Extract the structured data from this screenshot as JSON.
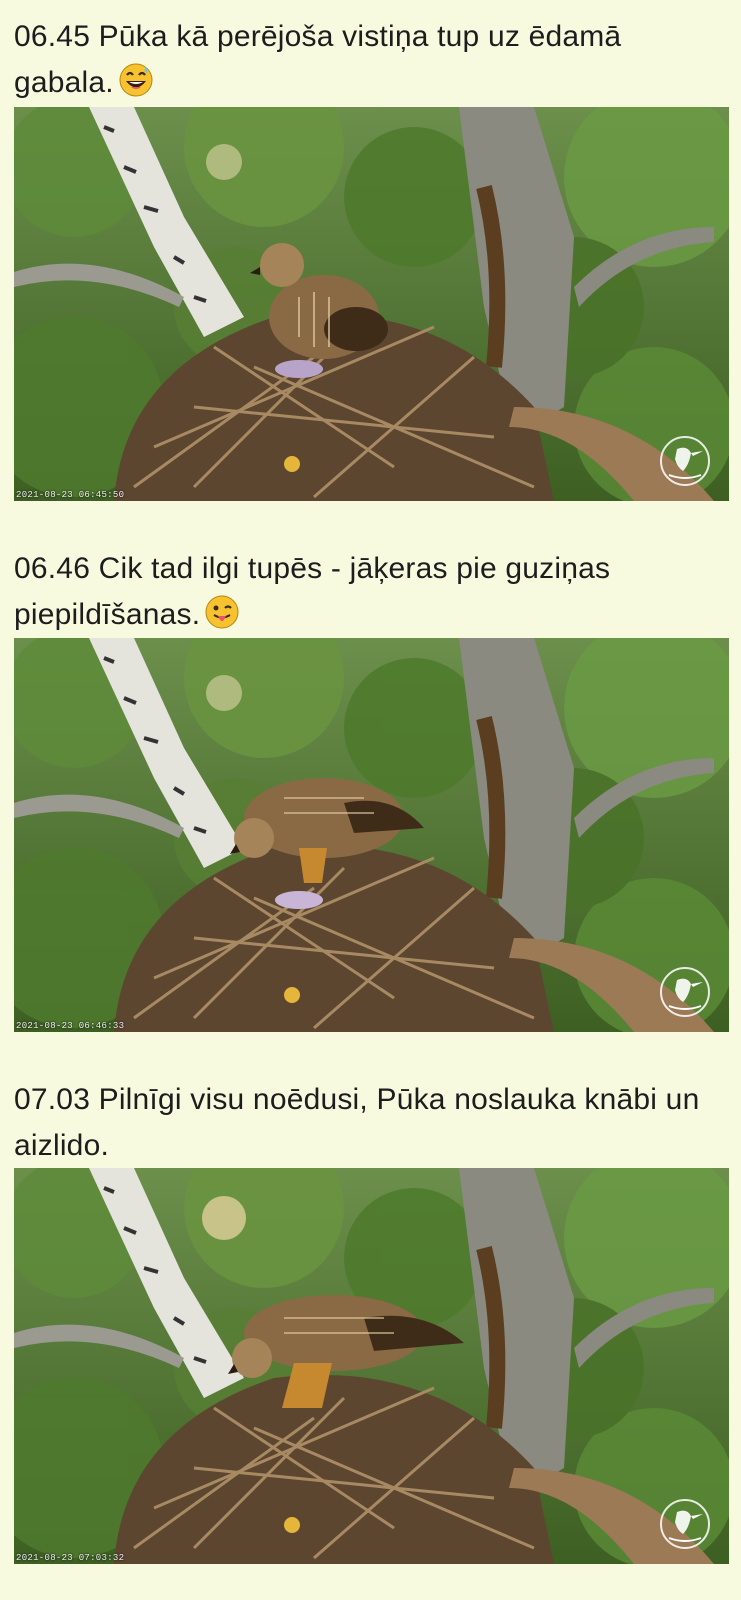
{
  "posts": [
    {
      "caption": "06.45 Pūka kā perējoša vistiņa tup uz ēdamā gabala.",
      "emoji": "grinning-face-with-sweat",
      "photo": {
        "timestamp": "2021-08-23 06:45:50",
        "bird_pose": "sitting",
        "watermark": "Latvijas Dabas fonds"
      }
    },
    {
      "caption": "06.46 Cik tad ilgi tupēs - jāķeras pie guziņas piepildīšanas.",
      "emoji": "face-with-tongue",
      "photo": {
        "timestamp": "2021-08-23 06:46:33",
        "bird_pose": "feeding",
        "watermark": "Latvijas Dabas fonds"
      }
    },
    {
      "caption": "07.03 Pilnīgi visu noēdusi, Pūka noslauka knābi un aizlido.",
      "emoji": "",
      "photo": {
        "timestamp": "2021-08-23 07:03:32",
        "bird_pose": "feeding",
        "watermark": "Latvijas Dabas fonds"
      }
    }
  ],
  "colors": {
    "background": "#f7fadf",
    "text": "#1d1d1d",
    "foliage": "#4f7a2e",
    "nest": "#6b5237",
    "bird": "#8a6a44"
  }
}
